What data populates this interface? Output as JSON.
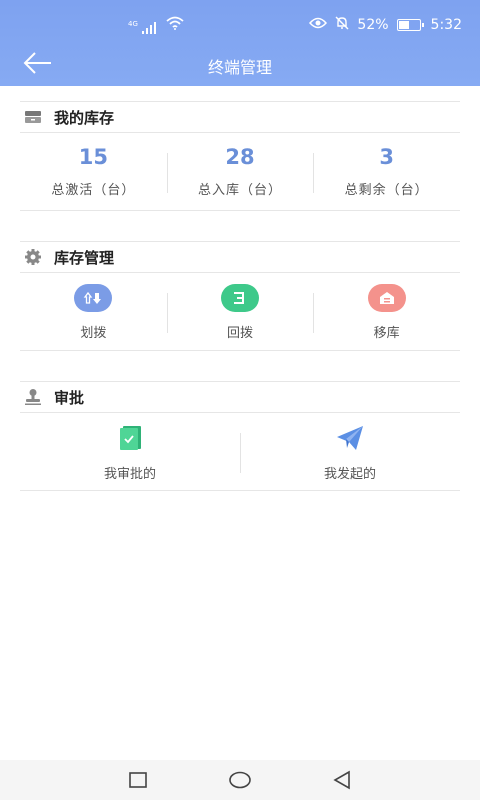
{
  "status_bar": {
    "network": "4G",
    "battery": "52%",
    "battery_level": 0.52,
    "time": "5:32",
    "icons": [
      "signal-icon",
      "wifi-icon",
      "eye-icon",
      "mute-bell-icon",
      "battery-icon"
    ]
  },
  "nav": {
    "title": "终端管理",
    "back_icon": "arrow-left-icon"
  },
  "inventory": {
    "title": "我的库存",
    "icon": "inventory-icon",
    "stats": [
      {
        "value": "15",
        "label": "总激活（台）"
      },
      {
        "value": "28",
        "label": "总入库（台）"
      },
      {
        "value": "3",
        "label": "总剩余（台）"
      }
    ]
  },
  "management": {
    "title": "库存管理",
    "icon": "gear-icon",
    "actions": [
      {
        "label": "划拨",
        "icon": "transfer-icon",
        "color": "#7b9ce6"
      },
      {
        "label": "回拨",
        "icon": "callback-icon",
        "color": "#3ec98a"
      },
      {
        "label": "移库",
        "icon": "warehouse-icon",
        "color": "#f4928c"
      }
    ]
  },
  "approval": {
    "title": "审批",
    "icon": "stamp-icon",
    "items": [
      {
        "label": "我审批的",
        "icon": "approve-doc-icon",
        "color": "#3ec98a"
      },
      {
        "label": "我发起的",
        "icon": "paper-plane-icon",
        "color": "#5b8fe4"
      }
    ]
  },
  "colors": {
    "header": "#82a6f2",
    "stat_number": "#6a8fd8"
  }
}
